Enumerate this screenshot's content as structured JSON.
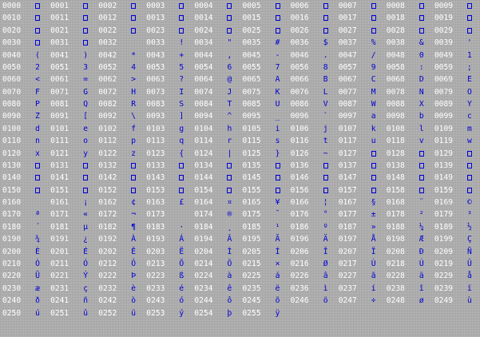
{
  "colors": {
    "background": "#ababab",
    "code_text": "#ffffff",
    "glyph_text": "#0000d8"
  },
  "rows": [
    [
      [
        "0000",
        ""
      ],
      [
        "0001",
        ""
      ],
      [
        "0002",
        ""
      ],
      [
        "0003",
        ""
      ],
      [
        "0004",
        ""
      ],
      [
        "0005",
        ""
      ],
      [
        "0006",
        ""
      ],
      [
        "0007",
        ""
      ],
      [
        "0008",
        ""
      ],
      [
        "0009",
        ""
      ]
    ],
    [
      [
        "0010",
        ""
      ],
      [
        "0011",
        ""
      ],
      [
        "0012",
        ""
      ],
      [
        "0013",
        ""
      ],
      [
        "0014",
        ""
      ],
      [
        "0015",
        ""
      ],
      [
        "0016",
        ""
      ],
      [
        "0017",
        ""
      ],
      [
        "0018",
        ""
      ],
      [
        "0019",
        ""
      ]
    ],
    [
      [
        "0020",
        ""
      ],
      [
        "0021",
        ""
      ],
      [
        "0022",
        ""
      ],
      [
        "0023",
        ""
      ],
      [
        "0024",
        ""
      ],
      [
        "0025",
        ""
      ],
      [
        "0026",
        ""
      ],
      [
        "0027",
        ""
      ],
      [
        "0028",
        ""
      ],
      [
        "0029",
        ""
      ]
    ],
    [
      [
        "0030",
        ""
      ],
      [
        "0031",
        ""
      ],
      [
        "0032",
        " "
      ],
      [
        "0033",
        "!"
      ],
      [
        "0034",
        "\""
      ],
      [
        "0035",
        "#"
      ],
      [
        "0036",
        "$"
      ],
      [
        "0037",
        "%"
      ],
      [
        "0038",
        "&"
      ],
      [
        "0039",
        "'"
      ]
    ],
    [
      [
        "0040",
        "("
      ],
      [
        "0041",
        ")"
      ],
      [
        "0042",
        "*"
      ],
      [
        "0043",
        "+"
      ],
      [
        "0044",
        ","
      ],
      [
        "0045",
        "-"
      ],
      [
        "0046",
        "."
      ],
      [
        "0047",
        "/"
      ],
      [
        "0048",
        "0"
      ],
      [
        "0049",
        "1"
      ]
    ],
    [
      [
        "0050",
        "2"
      ],
      [
        "0051",
        "3"
      ],
      [
        "0052",
        "4"
      ],
      [
        "0053",
        "5"
      ],
      [
        "0054",
        "6"
      ],
      [
        "0055",
        "7"
      ],
      [
        "0056",
        "8"
      ],
      [
        "0057",
        "9"
      ],
      [
        "0058",
        ":"
      ],
      [
        "0059",
        ";"
      ]
    ],
    [
      [
        "0060",
        "<"
      ],
      [
        "0061",
        "="
      ],
      [
        "0062",
        ">"
      ],
      [
        "0063",
        "?"
      ],
      [
        "0064",
        "@"
      ],
      [
        "0065",
        "A"
      ],
      [
        "0066",
        "B"
      ],
      [
        "0067",
        "C"
      ],
      [
        "0068",
        "D"
      ],
      [
        "0069",
        "E"
      ]
    ],
    [
      [
        "0070",
        "F"
      ],
      [
        "0071",
        "G"
      ],
      [
        "0072",
        "H"
      ],
      [
        "0073",
        "I"
      ],
      [
        "0074",
        "J"
      ],
      [
        "0075",
        "K"
      ],
      [
        "0076",
        "L"
      ],
      [
        "0077",
        "M"
      ],
      [
        "0078",
        "N"
      ],
      [
        "0079",
        "O"
      ]
    ],
    [
      [
        "0080",
        "P"
      ],
      [
        "0081",
        "Q"
      ],
      [
        "0082",
        "R"
      ],
      [
        "0083",
        "S"
      ],
      [
        "0084",
        "T"
      ],
      [
        "0085",
        "U"
      ],
      [
        "0086",
        "V"
      ],
      [
        "0087",
        "W"
      ],
      [
        "0088",
        "X"
      ],
      [
        "0089",
        "Y"
      ]
    ],
    [
      [
        "0090",
        "Z"
      ],
      [
        "0091",
        "["
      ],
      [
        "0092",
        "\\"
      ],
      [
        "0093",
        "]"
      ],
      [
        "0094",
        "^"
      ],
      [
        "0095",
        "_"
      ],
      [
        "0096",
        "`"
      ],
      [
        "0097",
        "a"
      ],
      [
        "0098",
        "b"
      ],
      [
        "0099",
        "c"
      ]
    ],
    [
      [
        "0100",
        "d"
      ],
      [
        "0101",
        "e"
      ],
      [
        "0102",
        "f"
      ],
      [
        "0103",
        "g"
      ],
      [
        "0104",
        "h"
      ],
      [
        "0105",
        "i"
      ],
      [
        "0106",
        "j"
      ],
      [
        "0107",
        "k"
      ],
      [
        "0108",
        "l"
      ],
      [
        "0109",
        "m"
      ]
    ],
    [
      [
        "0110",
        "n"
      ],
      [
        "0111",
        "o"
      ],
      [
        "0112",
        "p"
      ],
      [
        "0113",
        "q"
      ],
      [
        "0114",
        "r"
      ],
      [
        "0115",
        "s"
      ],
      [
        "0116",
        "t"
      ],
      [
        "0117",
        "u"
      ],
      [
        "0118",
        "v"
      ],
      [
        "0119",
        "w"
      ]
    ],
    [
      [
        "0120",
        "x"
      ],
      [
        "0121",
        "y"
      ],
      [
        "0122",
        "z"
      ],
      [
        "0123",
        "{"
      ],
      [
        "0124",
        "|"
      ],
      [
        "0125",
        "}"
      ],
      [
        "0126",
        "~"
      ],
      [
        "0127",
        ""
      ],
      [
        "0128",
        ""
      ],
      [
        "0129",
        ""
      ]
    ],
    [
      [
        "0130",
        ""
      ],
      [
        "0131",
        ""
      ],
      [
        "0132",
        ""
      ],
      [
        "0133",
        ""
      ],
      [
        "0134",
        ""
      ],
      [
        "0135",
        ""
      ],
      [
        "0136",
        ""
      ],
      [
        "0137",
        ""
      ],
      [
        "0138",
        ""
      ],
      [
        "0139",
        ""
      ]
    ],
    [
      [
        "0140",
        ""
      ],
      [
        "0141",
        ""
      ],
      [
        "0142",
        ""
      ],
      [
        "0143",
        ""
      ],
      [
        "0144",
        ""
      ],
      [
        "0145",
        ""
      ],
      [
        "0146",
        ""
      ],
      [
        "0147",
        ""
      ],
      [
        "0148",
        ""
      ],
      [
        "0149",
        ""
      ]
    ],
    [
      [
        "0150",
        ""
      ],
      [
        "0151",
        ""
      ],
      [
        "0152",
        ""
      ],
      [
        "0153",
        ""
      ],
      [
        "0154",
        ""
      ],
      [
        "0155",
        ""
      ],
      [
        "0156",
        ""
      ],
      [
        "0157",
        ""
      ],
      [
        "0158",
        ""
      ],
      [
        "0159",
        ""
      ]
    ],
    [
      [
        "0160",
        " "
      ],
      [
        "0161",
        "¡"
      ],
      [
        "0162",
        "¢"
      ],
      [
        "0163",
        "£"
      ],
      [
        "0164",
        "¤"
      ],
      [
        "0165",
        "¥"
      ],
      [
        "0166",
        "¦"
      ],
      [
        "0167",
        "§"
      ],
      [
        "0168",
        "¨"
      ],
      [
        "0169",
        "©"
      ]
    ],
    [
      [
        "0170",
        "ª"
      ],
      [
        "0171",
        "«"
      ],
      [
        "0172",
        "¬"
      ],
      [
        "0173",
        "­"
      ],
      [
        "0174",
        "®"
      ],
      [
        "0175",
        "¯"
      ],
      [
        "0176",
        "°"
      ],
      [
        "0177",
        "±"
      ],
      [
        "0178",
        "²"
      ],
      [
        "0179",
        "³"
      ]
    ],
    [
      [
        "0180",
        "´"
      ],
      [
        "0181",
        "µ"
      ],
      [
        "0182",
        "¶"
      ],
      [
        "0183",
        "·"
      ],
      [
        "0184",
        "¸"
      ],
      [
        "0185",
        "¹"
      ],
      [
        "0186",
        "º"
      ],
      [
        "0187",
        "»"
      ],
      [
        "0188",
        "¼"
      ],
      [
        "0189",
        "½"
      ]
    ],
    [
      [
        "0190",
        "¾"
      ],
      [
        "0191",
        "¿"
      ],
      [
        "0192",
        "À"
      ],
      [
        "0193",
        "Á"
      ],
      [
        "0194",
        "Â"
      ],
      [
        "0195",
        "Ã"
      ],
      [
        "0196",
        "Ä"
      ],
      [
        "0197",
        "Å"
      ],
      [
        "0198",
        "Æ"
      ],
      [
        "0199",
        "Ç"
      ]
    ],
    [
      [
        "0200",
        "È"
      ],
      [
        "0201",
        "É"
      ],
      [
        "0202",
        "Ê"
      ],
      [
        "0203",
        "Ë"
      ],
      [
        "0204",
        "Ì"
      ],
      [
        "0205",
        "Í"
      ],
      [
        "0206",
        "Î"
      ],
      [
        "0207",
        "Ï"
      ],
      [
        "0208",
        "Ð"
      ],
      [
        "0209",
        "Ñ"
      ]
    ],
    [
      [
        "0210",
        "Ò"
      ],
      [
        "0211",
        "Ó"
      ],
      [
        "0212",
        "Ô"
      ],
      [
        "0213",
        "Õ"
      ],
      [
        "0214",
        "Ö"
      ],
      [
        "0215",
        "×"
      ],
      [
        "0216",
        "Ø"
      ],
      [
        "0217",
        "Ù"
      ],
      [
        "0218",
        "Ú"
      ],
      [
        "0219",
        "Û"
      ]
    ],
    [
      [
        "0220",
        "Ü"
      ],
      [
        "0221",
        "Ý"
      ],
      [
        "0222",
        "Þ"
      ],
      [
        "0223",
        "ß"
      ],
      [
        "0224",
        "à"
      ],
      [
        "0225",
        "á"
      ],
      [
        "0226",
        "â"
      ],
      [
        "0227",
        "ã"
      ],
      [
        "0228",
        "ä"
      ],
      [
        "0229",
        "å"
      ]
    ],
    [
      [
        "0230",
        "æ"
      ],
      [
        "0231",
        "ç"
      ],
      [
        "0232",
        "è"
      ],
      [
        "0233",
        "é"
      ],
      [
        "0234",
        "ê"
      ],
      [
        "0235",
        "ë"
      ],
      [
        "0236",
        "ì"
      ],
      [
        "0237",
        "í"
      ],
      [
        "0238",
        "î"
      ],
      [
        "0239",
        "ï"
      ]
    ],
    [
      [
        "0240",
        "ð"
      ],
      [
        "0241",
        "ñ"
      ],
      [
        "0242",
        "ò"
      ],
      [
        "0243",
        "ó"
      ],
      [
        "0244",
        "ô"
      ],
      [
        "0245",
        "õ"
      ],
      [
        "0246",
        "ö"
      ],
      [
        "0247",
        "÷"
      ],
      [
        "0248",
        "ø"
      ],
      [
        "0249",
        "ù"
      ]
    ],
    [
      [
        "0250",
        "ú"
      ],
      [
        "0251",
        "û"
      ],
      [
        "0252",
        "ü"
      ],
      [
        "0253",
        "ý"
      ],
      [
        "0254",
        "þ"
      ],
      [
        "0255",
        "ÿ"
      ]
    ]
  ]
}
